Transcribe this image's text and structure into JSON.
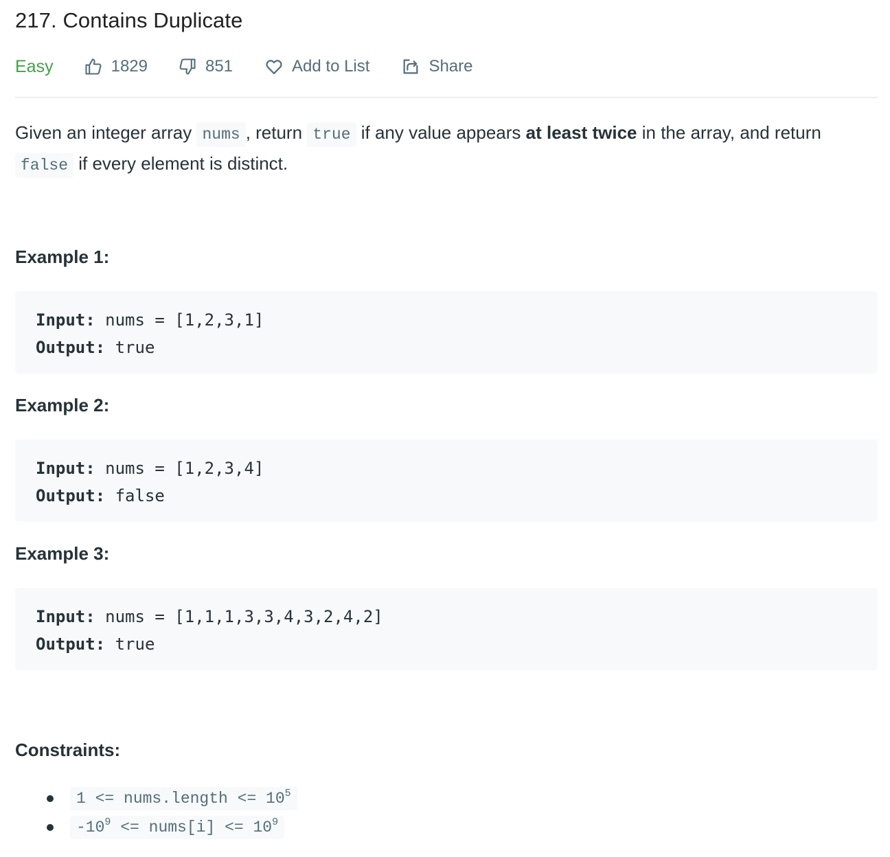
{
  "header": {
    "title": "217. Contains Duplicate",
    "difficulty": "Easy",
    "difficulty_color": "#43a047",
    "likes": "1829",
    "dislikes": "851",
    "add_to_list": "Add to List",
    "share": "Share",
    "icons": {
      "like": "thumbs-up-icon",
      "dislike": "thumbs-down-icon",
      "add_to_list": "heart-icon",
      "share": "share-icon"
    }
  },
  "description": {
    "p1": "Given an integer array ",
    "c1": "nums",
    "p2": ", return ",
    "c2": "true",
    "p3": " if any value appears ",
    "bold": "at least twice",
    "p4": " in the array, and return ",
    "c3": "false",
    "p5": " if every element is distinct."
  },
  "examples": [
    {
      "heading": "Example 1:",
      "input_label": "Input:",
      "input_value": " nums = [1,2,3,1]",
      "output_label": "Output:",
      "output_value": " true"
    },
    {
      "heading": "Example 2:",
      "input_label": "Input:",
      "input_value": " nums = [1,2,3,4]",
      "output_label": "Output:",
      "output_value": " false"
    },
    {
      "heading": "Example 3:",
      "input_label": "Input:",
      "input_value": " nums = [1,1,1,3,3,4,3,2,4,2]",
      "output_label": "Output:",
      "output_value": " true"
    }
  ],
  "constraints": {
    "heading": "Constraints:",
    "items": [
      {
        "pre": "1 <= nums.length <= 10",
        "sup": "5",
        "post": ""
      },
      {
        "pre": "-10",
        "sup": "9",
        "mid": " <= nums[i] <= 10",
        "sup2": "9"
      }
    ]
  }
}
